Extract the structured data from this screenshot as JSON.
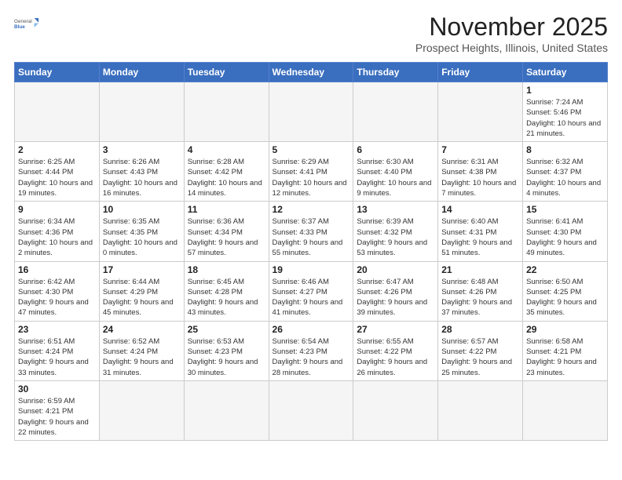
{
  "logo": {
    "line1": "General",
    "line2": "Blue"
  },
  "title": "November 2025",
  "subtitle": "Prospect Heights, Illinois, United States",
  "days_of_week": [
    "Sunday",
    "Monday",
    "Tuesday",
    "Wednesday",
    "Thursday",
    "Friday",
    "Saturday"
  ],
  "weeks": [
    [
      {
        "day": "",
        "info": ""
      },
      {
        "day": "",
        "info": ""
      },
      {
        "day": "",
        "info": ""
      },
      {
        "day": "",
        "info": ""
      },
      {
        "day": "",
        "info": ""
      },
      {
        "day": "",
        "info": ""
      },
      {
        "day": "1",
        "info": "Sunrise: 7:24 AM\nSunset: 5:46 PM\nDaylight: 10 hours and 21 minutes."
      }
    ],
    [
      {
        "day": "2",
        "info": "Sunrise: 6:25 AM\nSunset: 4:44 PM\nDaylight: 10 hours and 19 minutes."
      },
      {
        "day": "3",
        "info": "Sunrise: 6:26 AM\nSunset: 4:43 PM\nDaylight: 10 hours and 16 minutes."
      },
      {
        "day": "4",
        "info": "Sunrise: 6:28 AM\nSunset: 4:42 PM\nDaylight: 10 hours and 14 minutes."
      },
      {
        "day": "5",
        "info": "Sunrise: 6:29 AM\nSunset: 4:41 PM\nDaylight: 10 hours and 12 minutes."
      },
      {
        "day": "6",
        "info": "Sunrise: 6:30 AM\nSunset: 4:40 PM\nDaylight: 10 hours and 9 minutes."
      },
      {
        "day": "7",
        "info": "Sunrise: 6:31 AM\nSunset: 4:38 PM\nDaylight: 10 hours and 7 minutes."
      },
      {
        "day": "8",
        "info": "Sunrise: 6:32 AM\nSunset: 4:37 PM\nDaylight: 10 hours and 4 minutes."
      }
    ],
    [
      {
        "day": "9",
        "info": "Sunrise: 6:34 AM\nSunset: 4:36 PM\nDaylight: 10 hours and 2 minutes."
      },
      {
        "day": "10",
        "info": "Sunrise: 6:35 AM\nSunset: 4:35 PM\nDaylight: 10 hours and 0 minutes."
      },
      {
        "day": "11",
        "info": "Sunrise: 6:36 AM\nSunset: 4:34 PM\nDaylight: 9 hours and 57 minutes."
      },
      {
        "day": "12",
        "info": "Sunrise: 6:37 AM\nSunset: 4:33 PM\nDaylight: 9 hours and 55 minutes."
      },
      {
        "day": "13",
        "info": "Sunrise: 6:39 AM\nSunset: 4:32 PM\nDaylight: 9 hours and 53 minutes."
      },
      {
        "day": "14",
        "info": "Sunrise: 6:40 AM\nSunset: 4:31 PM\nDaylight: 9 hours and 51 minutes."
      },
      {
        "day": "15",
        "info": "Sunrise: 6:41 AM\nSunset: 4:30 PM\nDaylight: 9 hours and 49 minutes."
      }
    ],
    [
      {
        "day": "16",
        "info": "Sunrise: 6:42 AM\nSunset: 4:30 PM\nDaylight: 9 hours and 47 minutes."
      },
      {
        "day": "17",
        "info": "Sunrise: 6:44 AM\nSunset: 4:29 PM\nDaylight: 9 hours and 45 minutes."
      },
      {
        "day": "18",
        "info": "Sunrise: 6:45 AM\nSunset: 4:28 PM\nDaylight: 9 hours and 43 minutes."
      },
      {
        "day": "19",
        "info": "Sunrise: 6:46 AM\nSunset: 4:27 PM\nDaylight: 9 hours and 41 minutes."
      },
      {
        "day": "20",
        "info": "Sunrise: 6:47 AM\nSunset: 4:26 PM\nDaylight: 9 hours and 39 minutes."
      },
      {
        "day": "21",
        "info": "Sunrise: 6:48 AM\nSunset: 4:26 PM\nDaylight: 9 hours and 37 minutes."
      },
      {
        "day": "22",
        "info": "Sunrise: 6:50 AM\nSunset: 4:25 PM\nDaylight: 9 hours and 35 minutes."
      }
    ],
    [
      {
        "day": "23",
        "info": "Sunrise: 6:51 AM\nSunset: 4:24 PM\nDaylight: 9 hours and 33 minutes."
      },
      {
        "day": "24",
        "info": "Sunrise: 6:52 AM\nSunset: 4:24 PM\nDaylight: 9 hours and 31 minutes."
      },
      {
        "day": "25",
        "info": "Sunrise: 6:53 AM\nSunset: 4:23 PM\nDaylight: 9 hours and 30 minutes."
      },
      {
        "day": "26",
        "info": "Sunrise: 6:54 AM\nSunset: 4:23 PM\nDaylight: 9 hours and 28 minutes."
      },
      {
        "day": "27",
        "info": "Sunrise: 6:55 AM\nSunset: 4:22 PM\nDaylight: 9 hours and 26 minutes."
      },
      {
        "day": "28",
        "info": "Sunrise: 6:57 AM\nSunset: 4:22 PM\nDaylight: 9 hours and 25 minutes."
      },
      {
        "day": "29",
        "info": "Sunrise: 6:58 AM\nSunset: 4:21 PM\nDaylight: 9 hours and 23 minutes."
      }
    ],
    [
      {
        "day": "30",
        "info": "Sunrise: 6:59 AM\nSunset: 4:21 PM\nDaylight: 9 hours and 22 minutes."
      },
      {
        "day": "",
        "info": ""
      },
      {
        "day": "",
        "info": ""
      },
      {
        "day": "",
        "info": ""
      },
      {
        "day": "",
        "info": ""
      },
      {
        "day": "",
        "info": ""
      },
      {
        "day": "",
        "info": ""
      }
    ]
  ]
}
